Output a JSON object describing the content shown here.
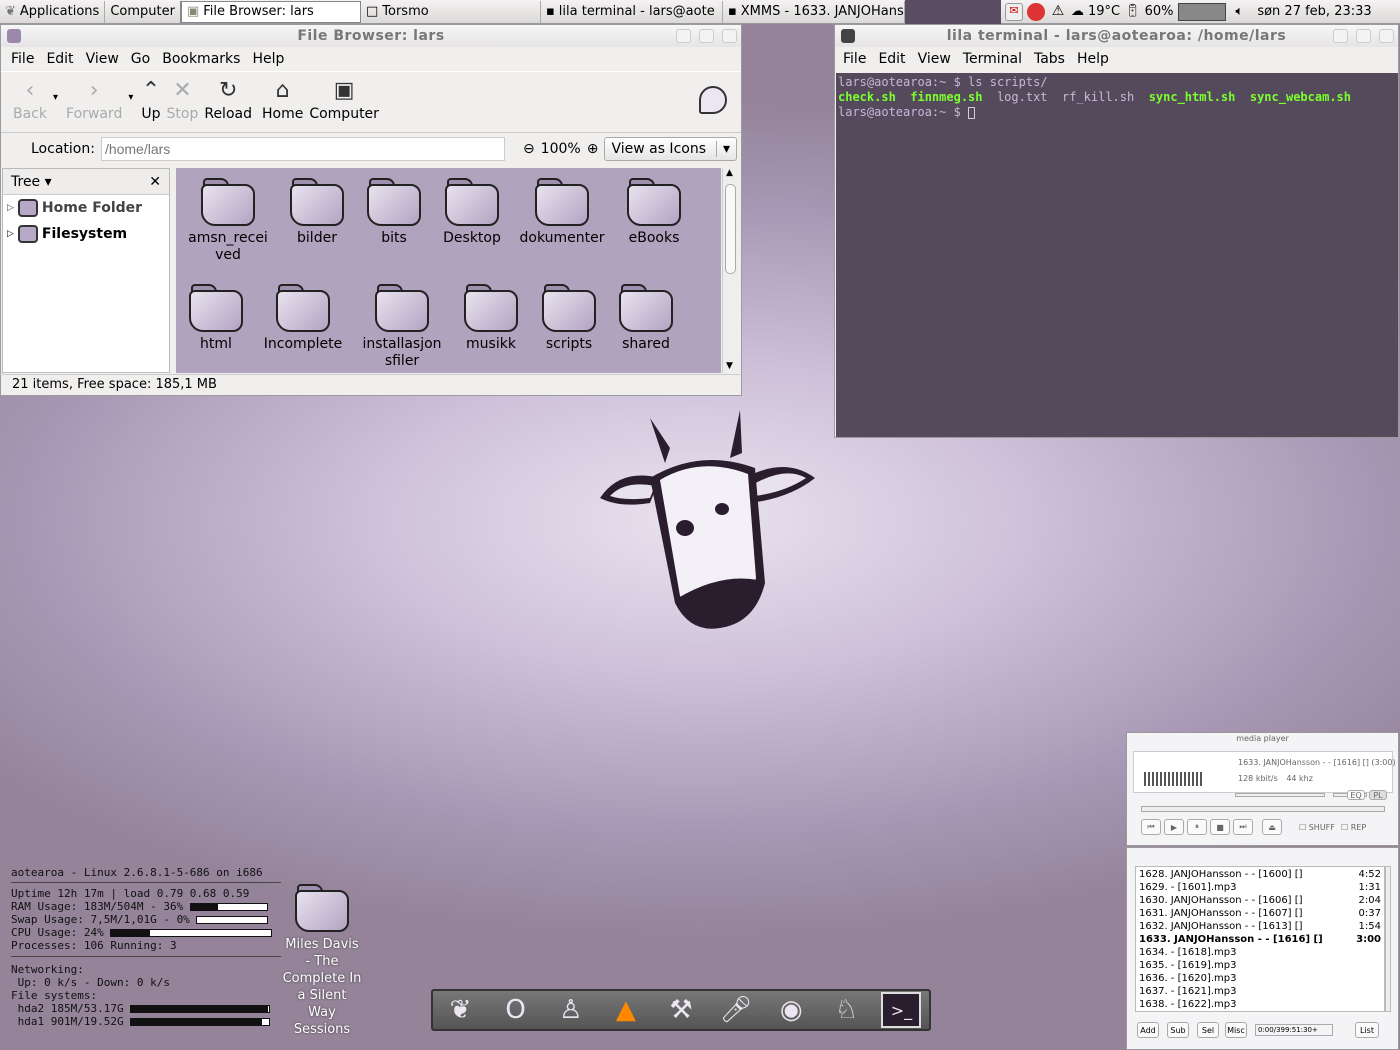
{
  "panel": {
    "apps_label": "Applications",
    "computer_label": "Computer",
    "tasks": [
      "File Browser: lars",
      "Torsmo",
      "lila terminal - lars@aote",
      "XMMS - 1633. JANJOHans"
    ],
    "weather": "19°C",
    "battery": "60%",
    "clock": "søn 27 feb, 23:33"
  },
  "filebrowser": {
    "title": "File Browser: lars",
    "menu": [
      "File",
      "Edit",
      "View",
      "Go",
      "Bookmarks",
      "Help"
    ],
    "toolbar": {
      "back": "Back",
      "forward": "Forward",
      "up": "Up",
      "stop": "Stop",
      "reload": "Reload",
      "home": "Home",
      "computer": "Computer"
    },
    "location_label": "Location:",
    "location_value": "/home/lars",
    "zoom": "100%",
    "view_mode": "View as Icons",
    "side_title": "Tree",
    "tree": [
      "Home Folder",
      "Filesystem"
    ],
    "files": [
      {
        "name": "amsn_received",
        "label": "amsn_recei\nved"
      },
      {
        "name": "bilder",
        "label": "bilder"
      },
      {
        "name": "bits",
        "label": "bits"
      },
      {
        "name": "Desktop",
        "label": "Desktop"
      },
      {
        "name": "dokumenter",
        "label": "dokumenter"
      },
      {
        "name": "eBooks",
        "label": "eBooks"
      },
      {
        "name": "html",
        "label": "html"
      },
      {
        "name": "Incomplete",
        "label": "Incomplete"
      },
      {
        "name": "installasjonsfiler",
        "label": "installasjon\nsfiler"
      },
      {
        "name": "musikk",
        "label": "musikk"
      },
      {
        "name": "scripts",
        "label": "scripts"
      },
      {
        "name": "shared",
        "label": "shared"
      }
    ],
    "status": "21 items, Free space: 185,1 MB"
  },
  "terminal": {
    "title": "lila terminal - lars@aotearoa: /home/lars",
    "menu": [
      "File",
      "Edit",
      "View",
      "Terminal",
      "Tabs",
      "Help"
    ],
    "prompt1": "lars@aotearoa:~ $ ls scripts/",
    "files": [
      "check.sh",
      "finnmeg.sh",
      "log.txt",
      "rf_kill.sh",
      "sync_html.sh",
      "sync_webcam.sh"
    ],
    "prompt2": "lars@aotearoa:~ $ "
  },
  "conky": {
    "header": "aotearoa - Linux 2.6.8.1-5-686 on i686",
    "uptime": "Uptime 12h 17m  | load 0.79 0.68 0.59",
    "ram": "RAM Usage: 183M/504M - 36%",
    "ram_pct": 36,
    "swap": "Swap Usage: 7,5M/1,01G - 0%",
    "swap_pct": 0,
    "cpu": "CPU Usage: 24%",
    "cpu_pct": 24,
    "proc": "Processes: 106   Running: 3",
    "net": "Networking:",
    "netline": " Up: 0 k/s - Down: 0 k/s",
    "fs": "File systems:",
    "hda2": " hda2 185M/53.17G",
    "hda2_pct": 99,
    "hda1": " hda1 901M/19.52G",
    "hda1_pct": 95
  },
  "desktop_folder": "Miles Davis - The Complete In a Silent Way Sessions",
  "xmms": {
    "title": "media player",
    "song": "1633. JANJOHansson - - [1616] [] (3:00)",
    "bitrate": "128",
    "khz": "44",
    "shuff": "SHUFF",
    "rep": "REP",
    "eq": "EQ",
    "pl": "PL"
  },
  "playlist": [
    {
      "t": "1628. JANJOHansson - - [1600] []",
      "d": "4:52"
    },
    {
      "t": "1629. - [1601].mp3",
      "d": "1:31"
    },
    {
      "t": "1630. JANJOHansson - - [1606] []",
      "d": "2:04"
    },
    {
      "t": "1631. JANJOHansson - - [1607] []",
      "d": "0:37"
    },
    {
      "t": "1632. JANJOHansson - - [1613] []",
      "d": "1:54"
    },
    {
      "t": "1633. JANJOHansson - - [1616] []",
      "d": "3:00",
      "cur": true
    },
    {
      "t": "1634. - [1618].mp3",
      "d": ""
    },
    {
      "t": "1635. - [1619].mp3",
      "d": ""
    },
    {
      "t": "1636. - [1620].mp3",
      "d": ""
    },
    {
      "t": "1637. - [1621].mp3",
      "d": ""
    },
    {
      "t": "1638. - [1622].mp3",
      "d": ""
    }
  ],
  "pl_buttons": {
    "add": "Add",
    "sub": "Sub",
    "sel": "Sel",
    "misc": "Misc",
    "list": "List",
    "time": "0:00/399:51:30+"
  }
}
